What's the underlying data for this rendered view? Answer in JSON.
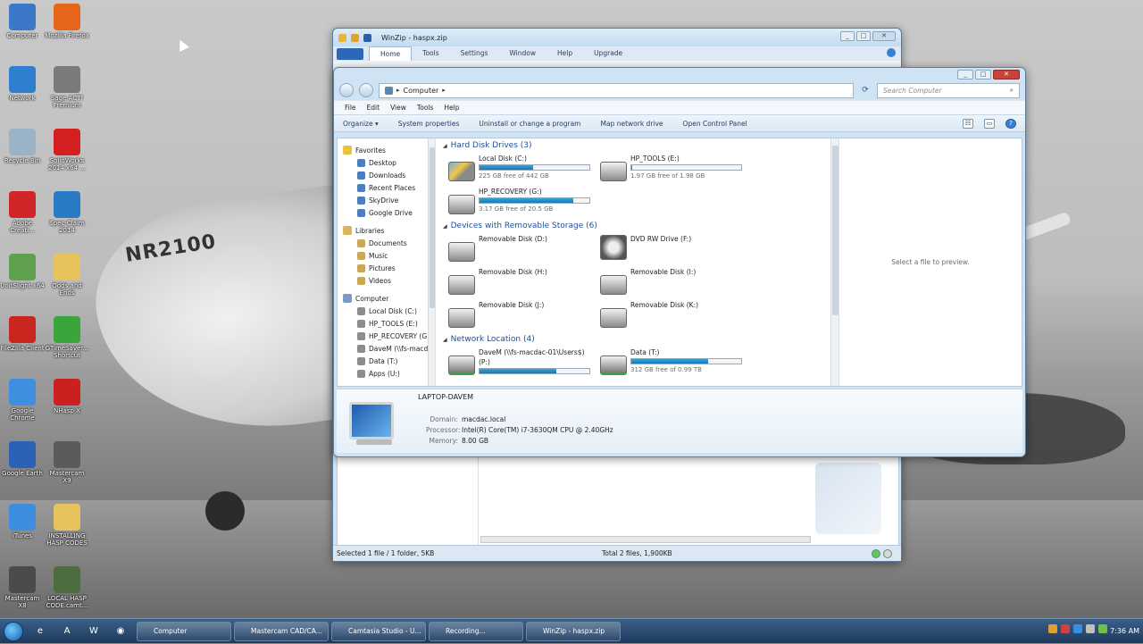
{
  "desktop": {
    "icons": [
      {
        "label": "Computer",
        "color": "#3b78c8"
      },
      {
        "label": "Mozilla Firefox",
        "color": "#e5661b"
      },
      {
        "label": "Network",
        "color": "#2f7fd1"
      },
      {
        "label": "Sage ACT! Premium",
        "color": "#7a7a7a"
      },
      {
        "label": "Recycle Bin",
        "color": "#9ab3c7"
      },
      {
        "label": "SolidWorks 2014 x64 ...",
        "color": "#d42020"
      },
      {
        "label": "Adobe Creati...",
        "color": "#d1252a"
      },
      {
        "label": "Spec-Claim 2014",
        "color": "#2b7bc4"
      },
      {
        "label": "UnitSlight x64",
        "color": "#5fa04f"
      },
      {
        "label": "Odds and Ends",
        "color": "#e6c35c"
      },
      {
        "label": "FileZilla Client",
        "color": "#c8261e"
      },
      {
        "label": "GTimeSaver... Shortcut",
        "color": "#3aa53a"
      },
      {
        "label": "Google Chrome",
        "color": "#3f8fe0"
      },
      {
        "label": "NHasp X",
        "color": "#cc1f1f"
      },
      {
        "label": "Google Earth",
        "color": "#2b62b8"
      },
      {
        "label": "Mastercam X9",
        "color": "#5b5b5b"
      },
      {
        "label": "iTunes",
        "color": "#3f8de0"
      },
      {
        "label": "INSTALLING HASP CODES",
        "color": "#e6c35c"
      },
      {
        "label": "Mastercam X8",
        "color": "#4b4b4b"
      },
      {
        "label": "LOCAL HASP CODE.camt...",
        "color": "#4d6d3f"
      }
    ],
    "wallpaper_text": "NR2100"
  },
  "winzip": {
    "title": "WinZip - haspx.zip",
    "tabs": [
      "Home",
      "Tools",
      "Settings",
      "Window",
      "Help",
      "Upgrade"
    ],
    "active_tab": "Home",
    "status_left": "Selected 1 file / 1 folder, 5KB",
    "status_right": "Total 2 files, 1,900KB"
  },
  "explorer": {
    "breadcrumb": "Computer",
    "search_placeholder": "Search Computer",
    "menu": [
      "File",
      "Edit",
      "View",
      "Tools",
      "Help"
    ],
    "commands": [
      "Organize ▾",
      "System properties",
      "Uninstall or change a program",
      "Map network drive",
      "Open Control Panel"
    ],
    "nav": {
      "favorites_label": "Favorites",
      "favorites": [
        "Desktop",
        "Downloads",
        "Recent Places",
        "SkyDrive",
        "Google Drive"
      ],
      "libraries_label": "Libraries",
      "libraries": [
        "Documents",
        "Music",
        "Pictures",
        "Videos"
      ],
      "computer_label": "Computer",
      "computer": [
        "Local Disk (C:)",
        "HP_TOOLS (E:)",
        "HP_RECOVERY (G:)",
        "DaveM (\\\\fs-macda",
        "Data (T:)",
        "Apps (U:)"
      ]
    },
    "sections": {
      "hdd": "Hard Disk Drives (3)",
      "removable": "Devices with Removable Storage (6)",
      "network": "Network Location (4)"
    },
    "hdd": [
      {
        "name": "Local Disk (C:)",
        "free": "225 GB free of 442 GB",
        "used_fraction": 0.49
      },
      {
        "name": "HP_TOOLS (E:)",
        "free": "1.97 GB free of 1.98 GB",
        "used_fraction": 0.01
      },
      {
        "name": "HP_RECOVERY (G:)",
        "free": "3.17 GB free of 20.5 GB",
        "used_fraction": 0.85
      }
    ],
    "removable": [
      "Removable Disk (D:)",
      "DVD RW Drive (F:)",
      "Removable Disk (H:)",
      "Removable Disk (I:)",
      "Removable Disk (J:)",
      "Removable Disk (K:)"
    ],
    "network": [
      {
        "name": "DaveM (\\\\fs-macdac-01\\Users$)",
        "name2": "(P:)",
        "free": "",
        "used_fraction": 0.7
      },
      {
        "name": "Data (T:)",
        "name2": "",
        "free": "312 GB free of 0.99 TB",
        "used_fraction": 0.7
      }
    ],
    "preview_text": "Select a file to preview.",
    "details": {
      "name": "LAPTOP-DAVEM",
      "domain_label": "Domain:",
      "domain": "macdac.local",
      "processor_label": "Processor:",
      "processor": "Intel(R) Core(TM) i7-3630QM CPU @ 2.40GHz",
      "memory_label": "Memory:",
      "memory": "8.00 GB"
    }
  },
  "taskbar": {
    "buttons": [
      "Computer",
      "Mastercam CAD/CA...",
      "Camtasia Studio - U...",
      "Recording...",
      "WinZip - haspx.zip"
    ],
    "clock": "7:36 AM"
  }
}
